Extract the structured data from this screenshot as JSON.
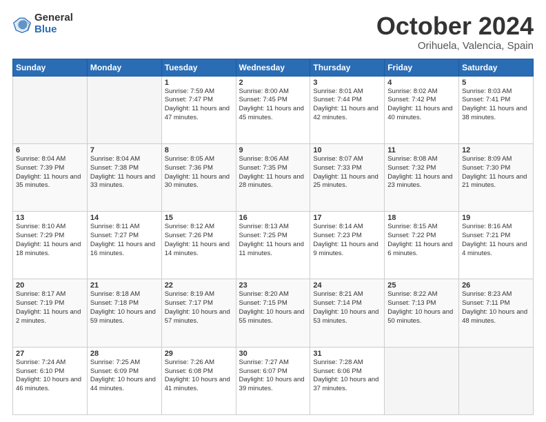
{
  "header": {
    "logo_general": "General",
    "logo_blue": "Blue",
    "title": "October 2024",
    "location": "Orihuela, Valencia, Spain"
  },
  "days_of_week": [
    "Sunday",
    "Monday",
    "Tuesday",
    "Wednesday",
    "Thursday",
    "Friday",
    "Saturday"
  ],
  "weeks": [
    [
      {
        "day": "",
        "info": ""
      },
      {
        "day": "",
        "info": ""
      },
      {
        "day": "1",
        "info": "Sunrise: 7:59 AM\nSunset: 7:47 PM\nDaylight: 11 hours and 47 minutes."
      },
      {
        "day": "2",
        "info": "Sunrise: 8:00 AM\nSunset: 7:45 PM\nDaylight: 11 hours and 45 minutes."
      },
      {
        "day": "3",
        "info": "Sunrise: 8:01 AM\nSunset: 7:44 PM\nDaylight: 11 hours and 42 minutes."
      },
      {
        "day": "4",
        "info": "Sunrise: 8:02 AM\nSunset: 7:42 PM\nDaylight: 11 hours and 40 minutes."
      },
      {
        "day": "5",
        "info": "Sunrise: 8:03 AM\nSunset: 7:41 PM\nDaylight: 11 hours and 38 minutes."
      }
    ],
    [
      {
        "day": "6",
        "info": "Sunrise: 8:04 AM\nSunset: 7:39 PM\nDaylight: 11 hours and 35 minutes."
      },
      {
        "day": "7",
        "info": "Sunrise: 8:04 AM\nSunset: 7:38 PM\nDaylight: 11 hours and 33 minutes."
      },
      {
        "day": "8",
        "info": "Sunrise: 8:05 AM\nSunset: 7:36 PM\nDaylight: 11 hours and 30 minutes."
      },
      {
        "day": "9",
        "info": "Sunrise: 8:06 AM\nSunset: 7:35 PM\nDaylight: 11 hours and 28 minutes."
      },
      {
        "day": "10",
        "info": "Sunrise: 8:07 AM\nSunset: 7:33 PM\nDaylight: 11 hours and 25 minutes."
      },
      {
        "day": "11",
        "info": "Sunrise: 8:08 AM\nSunset: 7:32 PM\nDaylight: 11 hours and 23 minutes."
      },
      {
        "day": "12",
        "info": "Sunrise: 8:09 AM\nSunset: 7:30 PM\nDaylight: 11 hours and 21 minutes."
      }
    ],
    [
      {
        "day": "13",
        "info": "Sunrise: 8:10 AM\nSunset: 7:29 PM\nDaylight: 11 hours and 18 minutes."
      },
      {
        "day": "14",
        "info": "Sunrise: 8:11 AM\nSunset: 7:27 PM\nDaylight: 11 hours and 16 minutes."
      },
      {
        "day": "15",
        "info": "Sunrise: 8:12 AM\nSunset: 7:26 PM\nDaylight: 11 hours and 14 minutes."
      },
      {
        "day": "16",
        "info": "Sunrise: 8:13 AM\nSunset: 7:25 PM\nDaylight: 11 hours and 11 minutes."
      },
      {
        "day": "17",
        "info": "Sunrise: 8:14 AM\nSunset: 7:23 PM\nDaylight: 11 hours and 9 minutes."
      },
      {
        "day": "18",
        "info": "Sunrise: 8:15 AM\nSunset: 7:22 PM\nDaylight: 11 hours and 6 minutes."
      },
      {
        "day": "19",
        "info": "Sunrise: 8:16 AM\nSunset: 7:21 PM\nDaylight: 11 hours and 4 minutes."
      }
    ],
    [
      {
        "day": "20",
        "info": "Sunrise: 8:17 AM\nSunset: 7:19 PM\nDaylight: 11 hours and 2 minutes."
      },
      {
        "day": "21",
        "info": "Sunrise: 8:18 AM\nSunset: 7:18 PM\nDaylight: 10 hours and 59 minutes."
      },
      {
        "day": "22",
        "info": "Sunrise: 8:19 AM\nSunset: 7:17 PM\nDaylight: 10 hours and 57 minutes."
      },
      {
        "day": "23",
        "info": "Sunrise: 8:20 AM\nSunset: 7:15 PM\nDaylight: 10 hours and 55 minutes."
      },
      {
        "day": "24",
        "info": "Sunrise: 8:21 AM\nSunset: 7:14 PM\nDaylight: 10 hours and 53 minutes."
      },
      {
        "day": "25",
        "info": "Sunrise: 8:22 AM\nSunset: 7:13 PM\nDaylight: 10 hours and 50 minutes."
      },
      {
        "day": "26",
        "info": "Sunrise: 8:23 AM\nSunset: 7:11 PM\nDaylight: 10 hours and 48 minutes."
      }
    ],
    [
      {
        "day": "27",
        "info": "Sunrise: 7:24 AM\nSunset: 6:10 PM\nDaylight: 10 hours and 46 minutes."
      },
      {
        "day": "28",
        "info": "Sunrise: 7:25 AM\nSunset: 6:09 PM\nDaylight: 10 hours and 44 minutes."
      },
      {
        "day": "29",
        "info": "Sunrise: 7:26 AM\nSunset: 6:08 PM\nDaylight: 10 hours and 41 minutes."
      },
      {
        "day": "30",
        "info": "Sunrise: 7:27 AM\nSunset: 6:07 PM\nDaylight: 10 hours and 39 minutes."
      },
      {
        "day": "31",
        "info": "Sunrise: 7:28 AM\nSunset: 6:06 PM\nDaylight: 10 hours and 37 minutes."
      },
      {
        "day": "",
        "info": ""
      },
      {
        "day": "",
        "info": ""
      }
    ]
  ]
}
